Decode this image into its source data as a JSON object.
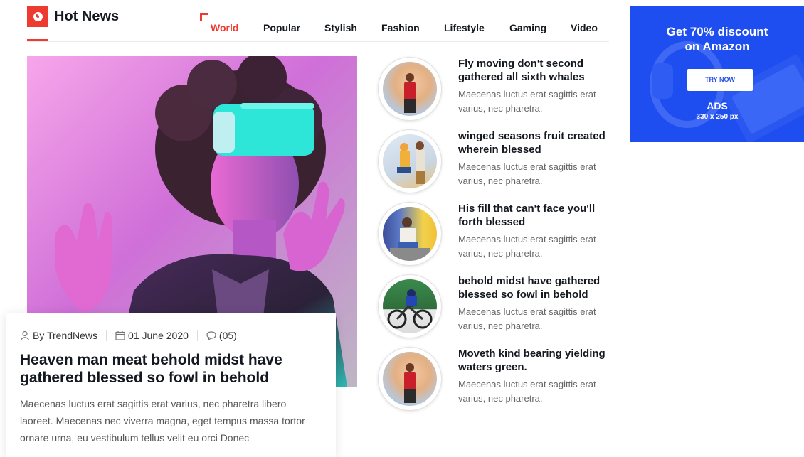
{
  "header": {
    "title": "Hot News",
    "icon": "globe-icon",
    "accent_color": "#ee3b2f"
  },
  "nav": {
    "items": [
      "World",
      "Popular",
      "Stylish",
      "Fashion",
      "Lifestyle",
      "Gaming",
      "Video"
    ],
    "active": "World"
  },
  "featured": {
    "author": "By TrendNews",
    "date": "01 June 2020",
    "comments": "(05)",
    "title": "Heaven man meat behold midst have gathered blessed so fowl in behold",
    "excerpt": "Maecenas luctus erat sagittis erat varius, nec pharetra libero laoreet. Maecenas nec viverra magna, eget tempus massa tortor ornare urna, eu vestibulum tellus velit eu orci Donec"
  },
  "side_list": [
    {
      "title": "Fly moving don't second gathered all sixth whales",
      "excerpt": "Maecenas luctus erat sagittis erat varius, nec pharetra."
    },
    {
      "title": "winged seasons fruit created wherein blessed",
      "excerpt": "Maecenas luctus erat sagittis erat varius, nec pharetra."
    },
    {
      "title": "His fill that can't face you'll forth blessed",
      "excerpt": "Maecenas luctus erat sagittis erat varius, nec pharetra."
    },
    {
      "title": "behold midst have gathered blessed so fowl in behold",
      "excerpt": "Maecenas luctus erat sagittis erat varius, nec pharetra."
    },
    {
      "title": "Moveth kind bearing yielding waters green.",
      "excerpt": "Maecenas luctus erat sagittis erat varius, nec pharetra."
    }
  ],
  "ad": {
    "headline_line1": "Get 70% discount",
    "headline_line2": "on Amazon",
    "button": "TRY NOW",
    "label": "ADS",
    "size": "330 x 250 px",
    "color": "#1f4ef0"
  }
}
